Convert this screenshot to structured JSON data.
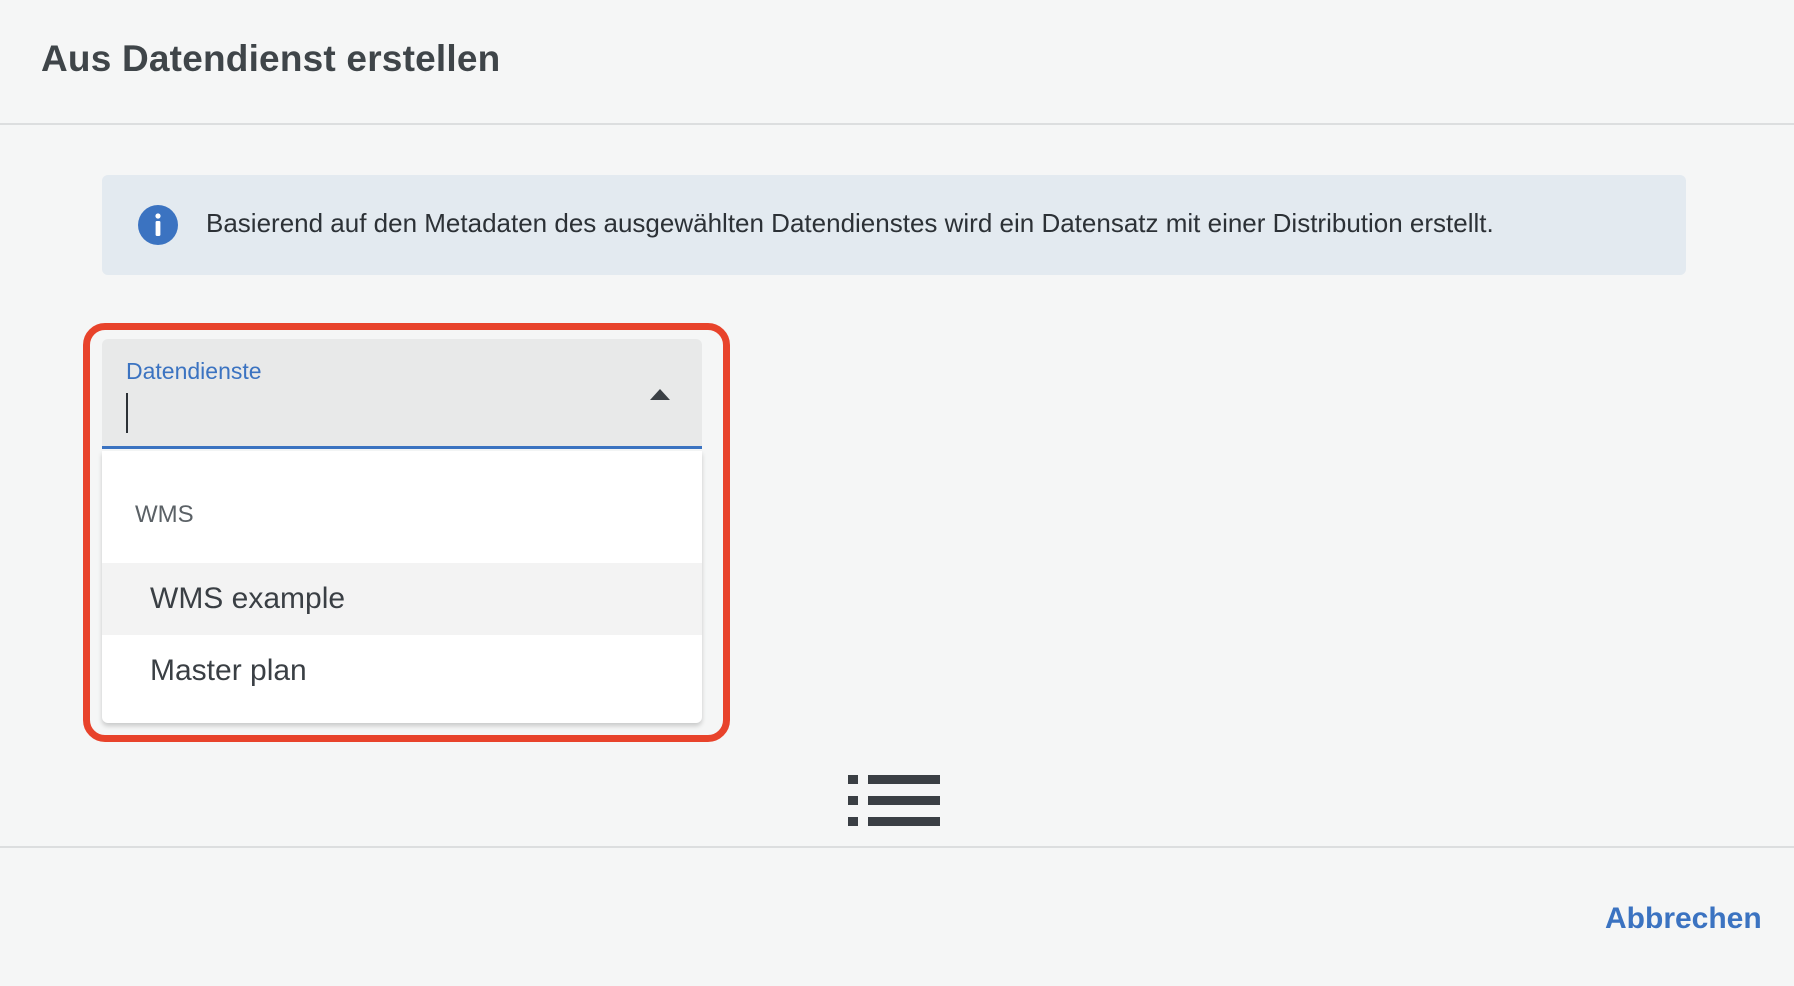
{
  "dialog": {
    "title": "Aus Datendienst erstellen"
  },
  "info": {
    "icon": "info-icon",
    "text": "Basierend auf den Metadaten des ausgewählten Datendienstes wird ein Datensatz mit einer Distribution erstellt."
  },
  "select": {
    "label": "Datendienste",
    "value": "",
    "expanded": true,
    "group_label": "WMS",
    "options": [
      {
        "label": "WMS example",
        "hovered": true
      },
      {
        "label": "Master plan",
        "hovered": false
      }
    ]
  },
  "loading_icon": "list-icon",
  "footer": {
    "cancel_label": "Abbrechen"
  },
  "colors": {
    "accent": "#3b73c1",
    "highlight": "#e8432b",
    "info_background": "#e3eaf0"
  }
}
